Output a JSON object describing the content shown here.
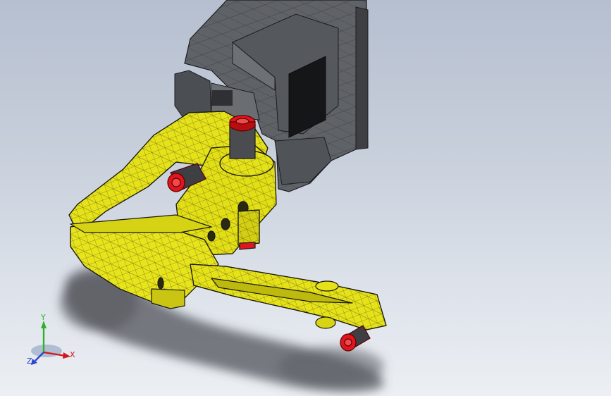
{
  "colors": {
    "background_top": "#b6bfd0",
    "background_bottom": "#eceff3",
    "housing_gray": "#5e6166",
    "housing_dark": "#2b2d30",
    "arm_yellow": "#e6e21a",
    "arm_edge": "#1a1a10",
    "cap_red": "#e0161c",
    "axis_x": "#d0181e",
    "axis_y": "#2fb12f",
    "axis_z": "#2846c8"
  },
  "triad": {
    "x_label": "X",
    "y_label": "Y",
    "z_label": "Z"
  }
}
